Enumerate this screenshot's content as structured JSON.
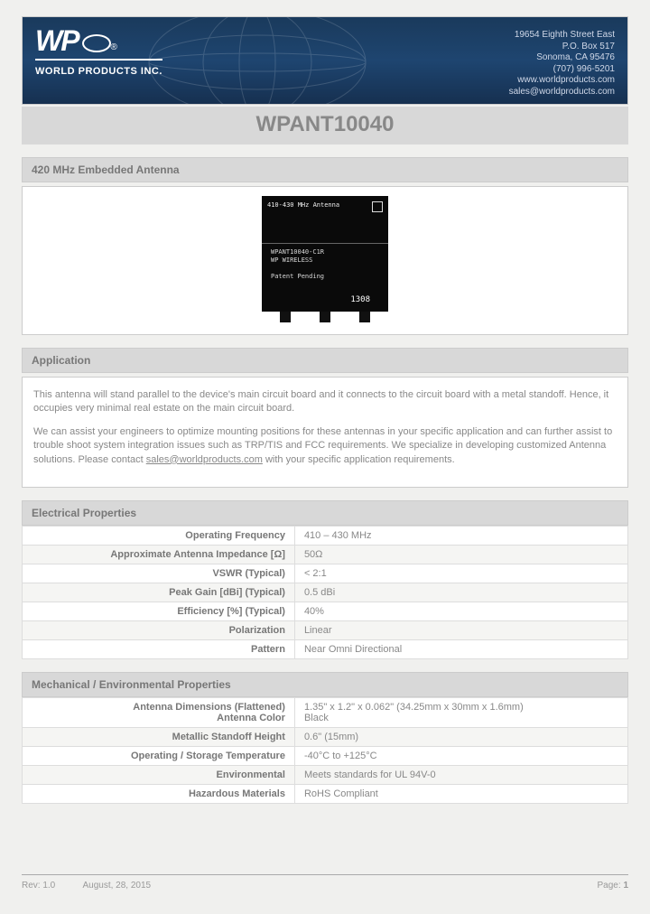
{
  "header": {
    "company_name": "WORLD PRODUCTS INC.",
    "logo_text": "WP",
    "contact": {
      "address1": "19654 Eighth Street East",
      "address2": "P.O. Box 517",
      "address3": "Sonoma, CA 95476",
      "phone": "(707) 996-5201",
      "web": "www.worldproducts.com",
      "email": "sales@worldproducts.com"
    }
  },
  "title": "WPANT10040",
  "product_header": "420 MHz Embedded Antenna",
  "product_image": {
    "top_label": "410-430 MHz Antenna",
    "model_lines": "WPANT10040-C1R\nWP WIRELESS\n\nPatent Pending",
    "batch": "1308"
  },
  "application": {
    "header": "Application",
    "para1": "This antenna will stand parallel to the device's main circuit board and it connects to the circuit board with a metal standoff. Hence, it occupies very minimal real estate on the main circuit board.",
    "para2_pre": "We can assist your engineers to optimize mounting positions for these antennas in your specific application and can further assist to trouble shoot system integration issues such as TRP/TIS and FCC requirements. We specialize in developing customized Antenna solutions. Please contact ",
    "para2_link": "sales@worldproducts.com",
    "para2_post": " with your specific application requirements."
  },
  "electrical": {
    "header": "Electrical Properties",
    "rows": [
      {
        "label": "Operating Frequency",
        "value": "410 – 430 MHz"
      },
      {
        "label": "Approximate Antenna Impedance [Ω]",
        "value": "50Ω"
      },
      {
        "label": "VSWR (Typical)",
        "value": "< 2:1"
      },
      {
        "label": "Peak Gain [dBi] (Typical)",
        "value": "0.5 dBi"
      },
      {
        "label": "Efficiency [%] (Typical)",
        "value": "40%"
      },
      {
        "label": "Polarization",
        "value": "Linear"
      },
      {
        "label": "Pattern",
        "value": "Near Omni Directional"
      }
    ]
  },
  "mechanical": {
    "header": "Mechanical / Environmental Properties",
    "rows": [
      {
        "label": "Antenna Dimensions (Flattened)\nAntenna Color",
        "value": "1.35\" x 1.2\" x 0.062\"     (34.25mm x 30mm x 1.6mm)\nBlack"
      },
      {
        "label": "Metallic Standoff Height",
        "value": "0.6\"       (15mm)"
      },
      {
        "label": "Operating / Storage Temperature",
        "value": "-40°C to +125°C"
      },
      {
        "label": "Environmental",
        "value": "Meets standards for UL 94V-0"
      },
      {
        "label": "Hazardous Materials",
        "value": "RoHS Compliant"
      }
    ]
  },
  "footer": {
    "rev_label": "Rev: 1.0",
    "date": "August, 28, 2015",
    "page_label": "Page:",
    "page_num": "1"
  }
}
